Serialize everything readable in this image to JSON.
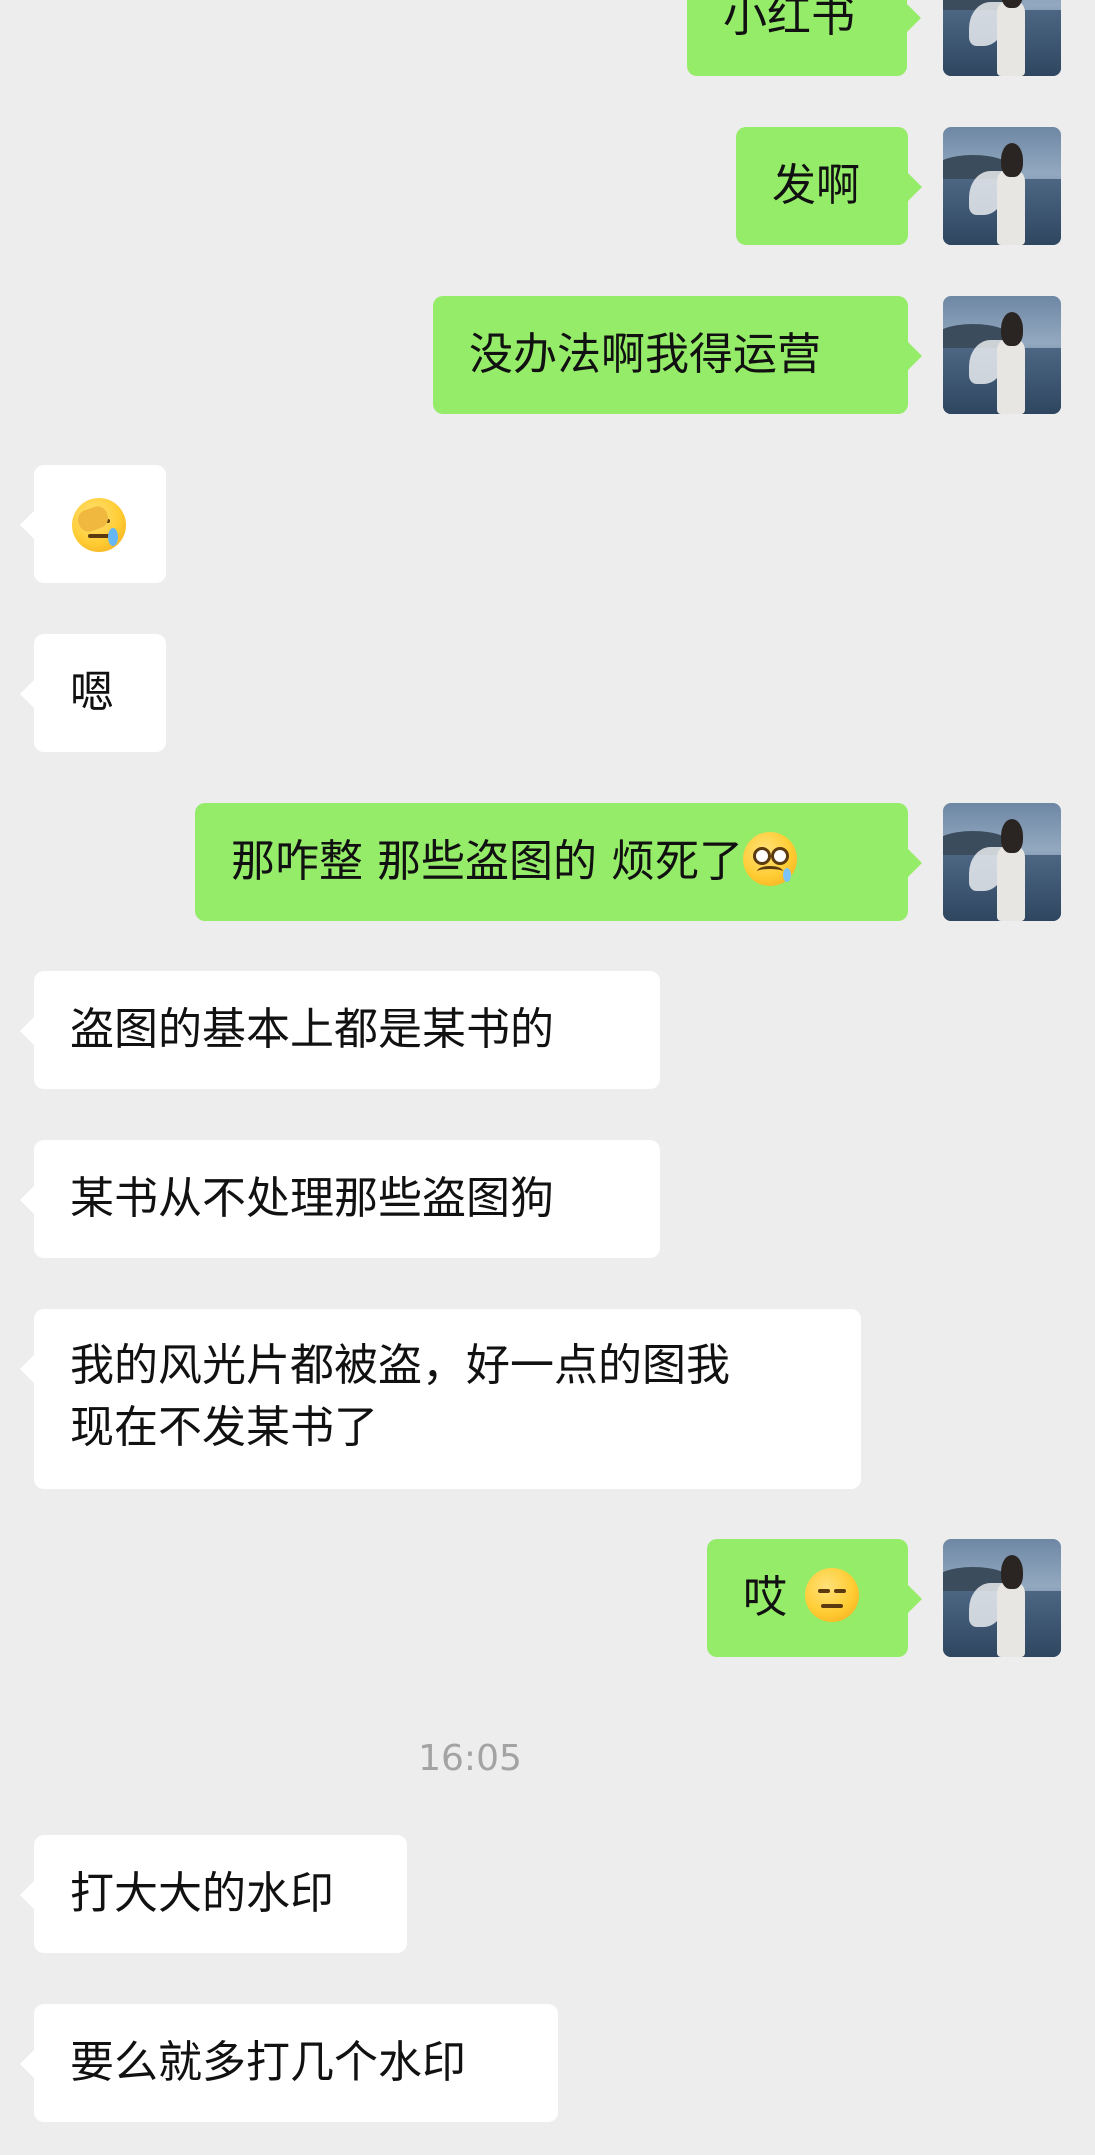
{
  "messages": [
    {
      "side": "right",
      "text": "小红书"
    },
    {
      "side": "right",
      "text": "发啊"
    },
    {
      "side": "right",
      "text": "没办法啊我得运营"
    },
    {
      "side": "left",
      "emoji": "face-palm-crying-emoji"
    },
    {
      "side": "left",
      "text": "嗯"
    },
    {
      "side": "right",
      "text": "那咋整 那些盗图的 烦死了",
      "emoji": "woozy-face-emoji"
    },
    {
      "side": "left",
      "text": "盗图的基本上都是某书的"
    },
    {
      "side": "left",
      "text": "某书从不处理那些盗图狗"
    },
    {
      "side": "left",
      "lines": [
        "我的风光片都被盗，好一点的图我",
        "现在不发某书了"
      ]
    },
    {
      "side": "right",
      "text": "哎",
      "emoji": "expressionless-face-emoji"
    },
    {
      "side": "left",
      "text": "打大大的水印"
    },
    {
      "side": "left",
      "text": "要么就多打几个水印"
    }
  ],
  "timestamp": "16:05",
  "colors": {
    "background": "#ededed",
    "sent_bubble": "#95ec69",
    "received_bubble": "#ffffff",
    "timestamp_text": "#a3a3a3"
  },
  "avatar": "user-avatar-photo-girl-by-sea"
}
